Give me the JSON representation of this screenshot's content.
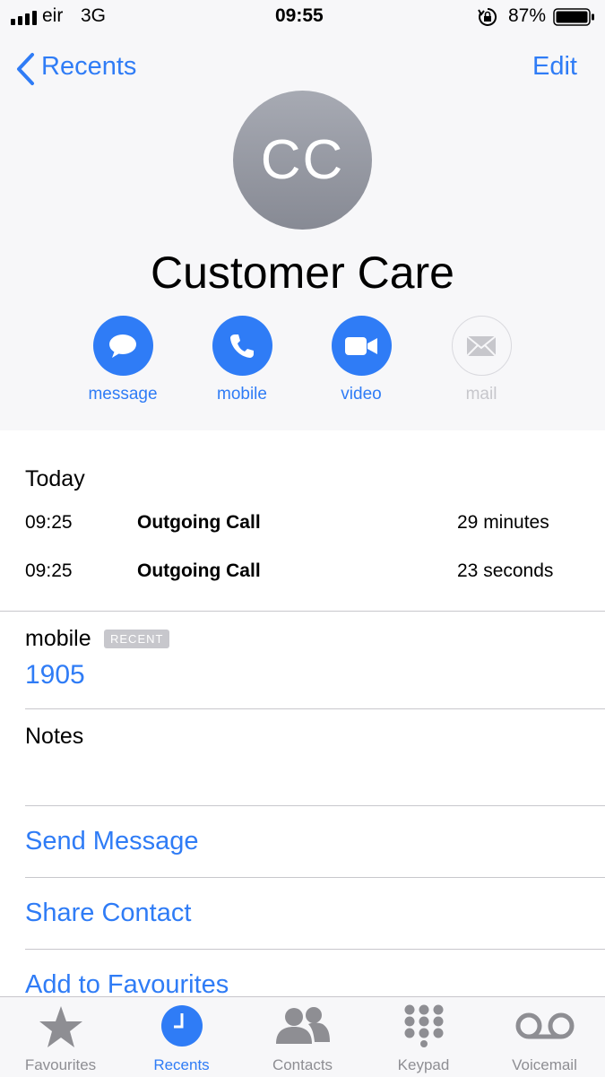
{
  "status_bar": {
    "carrier": "eir",
    "network": "3G",
    "time": "09:55",
    "battery": "87%",
    "battery_level": 0.87
  },
  "nav": {
    "back_label": "Recents",
    "edit_label": "Edit"
  },
  "contact": {
    "initials": "CC",
    "name": "Customer Care"
  },
  "actions": [
    {
      "label": "message",
      "icon": "message-bubble-icon",
      "enabled": true
    },
    {
      "label": "mobile",
      "icon": "phone-icon",
      "enabled": true
    },
    {
      "label": "video",
      "icon": "video-camera-icon",
      "enabled": true
    },
    {
      "label": "mail",
      "icon": "envelope-icon",
      "enabled": false
    }
  ],
  "history": {
    "title": "Today",
    "calls": [
      {
        "time": "09:25",
        "type": "Outgoing Call",
        "duration": "29 minutes"
      },
      {
        "time": "09:25",
        "type": "Outgoing Call",
        "duration": "23 seconds"
      }
    ]
  },
  "phone": {
    "label": "mobile",
    "badge": "RECENT",
    "number": "1905"
  },
  "notes_label": "Notes",
  "commands": [
    "Send Message",
    "Share Contact",
    "Add to Favourites"
  ],
  "tabbar": [
    {
      "label": "Favourites",
      "icon": "star-icon",
      "active": false
    },
    {
      "label": "Recents",
      "icon": "clock-icon",
      "active": true
    },
    {
      "label": "Contacts",
      "icon": "contacts-icon",
      "active": false
    },
    {
      "label": "Keypad",
      "icon": "keypad-icon",
      "active": false
    },
    {
      "label": "Voicemail",
      "icon": "voicemail-icon",
      "active": false
    }
  ],
  "colors": {
    "accent": "#2f7cf6",
    "inactive": "#8e8e93",
    "disabled": "#c7c7cc"
  }
}
